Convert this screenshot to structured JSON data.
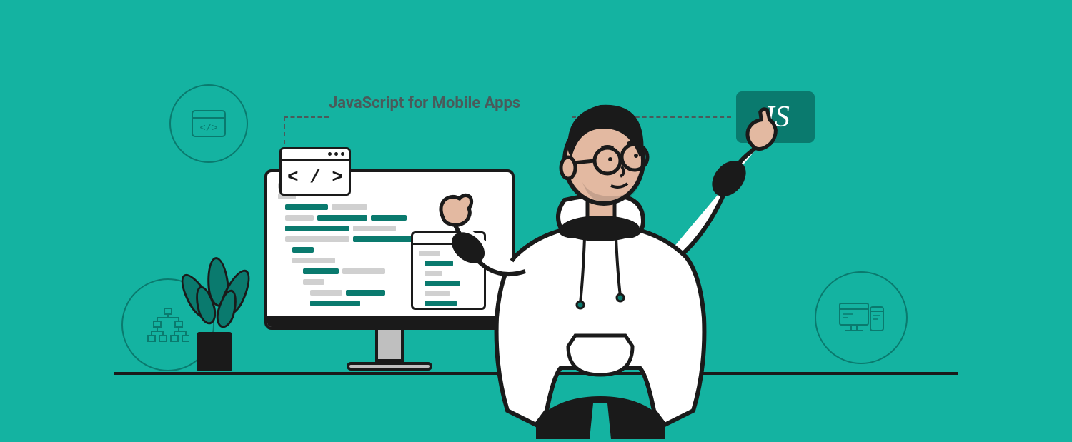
{
  "title": "JavaScript for Mobile Apps",
  "badge": "JS",
  "icons": {
    "top_left": "code-window-icon",
    "bottom_left": "hierarchy-icon",
    "bottom_right": "devices-icon"
  },
  "code_popup": {
    "symbol": "< / >"
  },
  "colors": {
    "background": "#14b3a1",
    "accent": "#0a7a6e",
    "dark": "#1a1a1a",
    "skin": "#e3b9a1"
  }
}
